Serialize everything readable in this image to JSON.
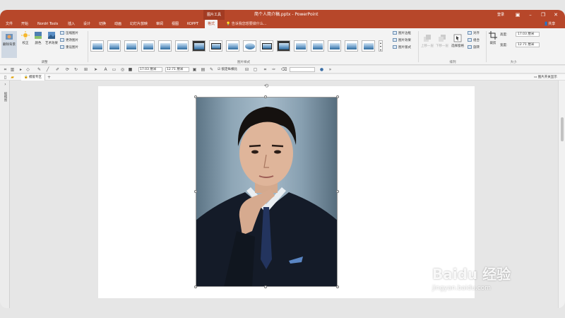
{
  "app": {
    "context_tab_group": "图片工具",
    "document_title": "简个人简介稿.pptx - PowerPoint",
    "login": "登录",
    "window_controls": [
      "▣",
      "–",
      "❐",
      "✕"
    ]
  },
  "menu": {
    "tabs": [
      "文件",
      "开始",
      "Nordri Tools",
      "插入",
      "设计",
      "切换",
      "动画",
      "幻灯片放映",
      "审阅",
      "视图",
      "KOPPT",
      "格式"
    ],
    "active_tab": "格式",
    "search_hint": "告诉我您想要做什么...",
    "share": "共享"
  },
  "ribbon": {
    "remove_background": "删除背景",
    "correct": "校正",
    "color": "颜色",
    "artistic_effects": "艺术效果",
    "compress_pictures": "压缩图片",
    "change_picture": "更改图片",
    "reset_picture": "重设图片",
    "group_adjust": "调整",
    "group_picture_styles": "图片样式",
    "picture_border": "图片边框",
    "picture_effects": "图片效果",
    "picture_layout": "图片版式",
    "bring_forward": "上移一层",
    "send_backward": "下移一层",
    "selection_pane": "选择窗格",
    "align": "对齐",
    "group": "组合",
    "rotate": "旋转",
    "group_arrange": "排列",
    "crop": "裁剪",
    "height_label": "高度:",
    "height_value": "17.03 厘米",
    "width_label": "宽度:",
    "width_value": "12.71 厘米",
    "group_size": "大小"
  },
  "toolbar2": {
    "height_value": "17.03 厘米",
    "width_value": "12.71 厘米",
    "lock_ratio": "锁定纵横比"
  },
  "toolbar3": {
    "doc_tab": "模版专区",
    "right_label": "图片开关显示"
  },
  "left_pane": {
    "label": "缩略图"
  },
  "watermark": {
    "logo": "Baidu 经验",
    "url": "jingyan.baidu.com"
  },
  "colors": {
    "accent": "#b7472a",
    "ribbon_bg": "#f3f3f3",
    "workspace_bg": "#e6e6e6"
  }
}
